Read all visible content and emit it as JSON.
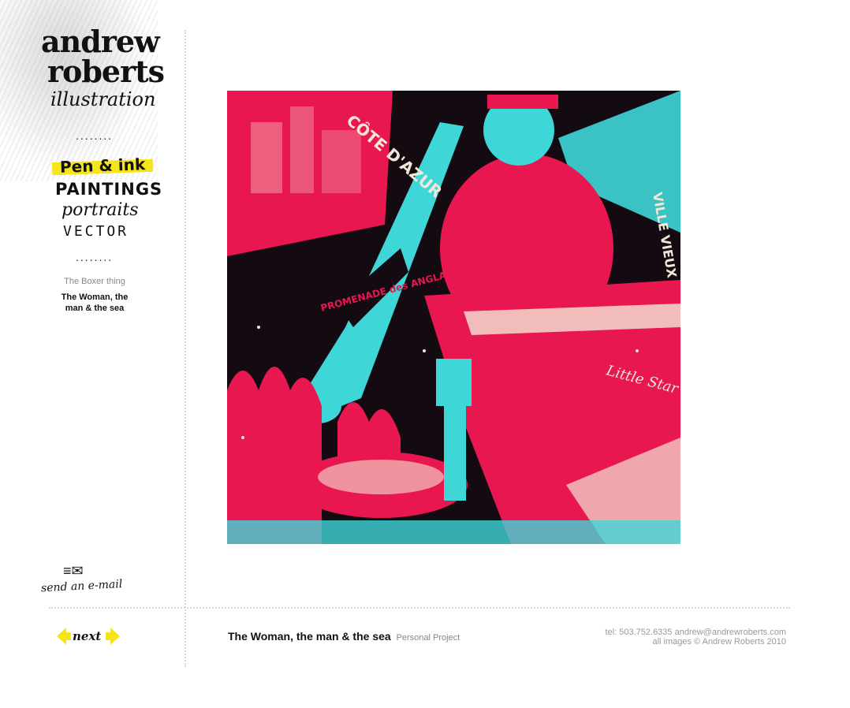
{
  "logo": {
    "line1": "andrew",
    "line2": "roberts",
    "line3": "illustration"
  },
  "nav": {
    "items": [
      {
        "label": "Pen & ink",
        "active": true
      },
      {
        "label": "PAINTINGS"
      },
      {
        "label": "portraits"
      },
      {
        "label": "VECTOR"
      }
    ],
    "separator": "........"
  },
  "sub_nav": {
    "items": [
      {
        "label": "The Boxer thing"
      },
      {
        "label": "The Woman, the man & the sea",
        "active": true
      }
    ]
  },
  "artwork": {
    "labels": {
      "cote_dazur": "CÔTE D'AZUR",
      "ville_vieux": "VILLE VIEUX",
      "promenade": "PROMENADE des ANGLAIS",
      "little_star": "Little Star"
    },
    "colors": {
      "pink": "#e8174f",
      "cyan": "#3fd6d8",
      "dark": "#140a12",
      "cream": "#f3e6d4"
    }
  },
  "email": {
    "label": "send an e-mail",
    "icon": "envelope-icon"
  },
  "pager": {
    "next_label": "next",
    "accent": "#f7e51b"
  },
  "caption": {
    "title": "The Woman, the man & the sea",
    "project": "Personal Project"
  },
  "contact": {
    "line1": "tel: 503.752.6335 andrew@andrewroberts.com",
    "line2": "all images © Andrew Roberts 2010"
  }
}
